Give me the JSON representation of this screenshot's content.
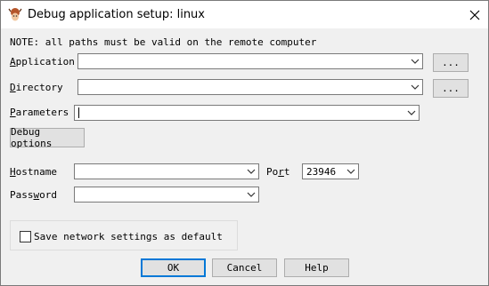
{
  "window": {
    "title": "Debug application setup: linux",
    "close_symbol": "✕"
  },
  "note": "NOTE: all paths must be valid on the remote computer",
  "fields": {
    "application": {
      "label_hotkey": "A",
      "label_rest": "pplication",
      "value": "",
      "browse_label": "..."
    },
    "directory": {
      "label_hotkey": "D",
      "label_rest": "irectory",
      "value": "",
      "browse_label": "..."
    },
    "parameters": {
      "label_hotkey": "P",
      "label_rest": "arameters",
      "value": ""
    },
    "hostname": {
      "label_hotkey": "H",
      "label_rest": "ostname",
      "value": ""
    },
    "port": {
      "label_pre": "Po",
      "label_hotkey": "r",
      "label_rest": "t",
      "value": "23946"
    },
    "password": {
      "label_pre": "Pass",
      "label_hotkey": "w",
      "label_rest": "ord",
      "value": ""
    }
  },
  "debug_options_label": "Debug options",
  "save_default": {
    "label": "Save network settings as default",
    "checked": false
  },
  "buttons": {
    "ok": "OK",
    "cancel": "Cancel",
    "help": "Help"
  },
  "colors": {
    "default_button_border": "#0078d7",
    "dialog_bg": "#f0f0f0"
  },
  "icons": {
    "app": "bug-icon",
    "close": "close-icon",
    "dropdown": "chevron-down-icon"
  }
}
